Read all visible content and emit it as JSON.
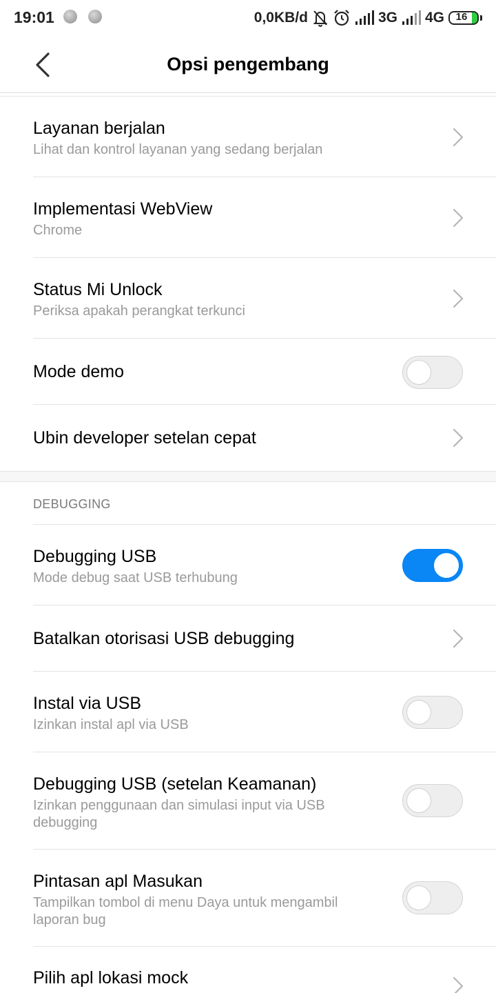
{
  "status_bar": {
    "time": "19:01",
    "data_speed": "0,0KB/d",
    "network_1": "3G",
    "network_2": "4G",
    "battery_level": "16",
    "icons": [
      "notification-dot-icon",
      "notification-dot-icon",
      "bell-muted-icon",
      "alarm-icon",
      "signal-icon",
      "signal-icon",
      "battery-icon"
    ]
  },
  "header": {
    "title": "Opsi pengembang",
    "back_icon": "chevron-left-icon"
  },
  "rows_top": [
    {
      "title": "Layanan berjalan",
      "subtitle": "Lihat dan kontrol layanan yang sedang berjalan",
      "control": "chevron"
    },
    {
      "title": "Implementasi WebView",
      "subtitle": "Chrome",
      "control": "chevron"
    },
    {
      "title": "Status Mi Unlock",
      "subtitle": "Periksa apakah perangkat terkunci",
      "control": "chevron"
    },
    {
      "title": "Mode demo",
      "control": "toggle",
      "on": false
    },
    {
      "title": "Ubin developer setelan cepat",
      "control": "chevron"
    }
  ],
  "debugging_section": {
    "header": "DEBUGGING",
    "rows": [
      {
        "title": "Debugging USB",
        "subtitle": "Mode debug saat USB terhubung",
        "control": "toggle",
        "on": true
      },
      {
        "title": "Batalkan otorisasi USB debugging",
        "control": "chevron"
      },
      {
        "title": "Instal via USB",
        "subtitle": "Izinkan instal apl via USB",
        "control": "toggle",
        "on": false
      },
      {
        "title": "Debugging USB (setelan Keamanan)",
        "subtitle": "Izinkan penggunaan dan simulasi input via USB debugging",
        "control": "toggle",
        "on": false
      },
      {
        "title": "Pintasan apl Masukan",
        "subtitle": "Tampilkan tombol di menu Daya untuk mengambil laporan bug",
        "control": "toggle",
        "on": false
      },
      {
        "title": "Pilih apl lokasi mock",
        "control": "chevron"
      }
    ]
  },
  "colors": {
    "toggle_on": "#0a86f5",
    "toggle_off": "#eeeeee",
    "subtitle": "#9a9a9a",
    "section_header": "#7a7a7a",
    "battery_fill": "#2ecc40"
  }
}
